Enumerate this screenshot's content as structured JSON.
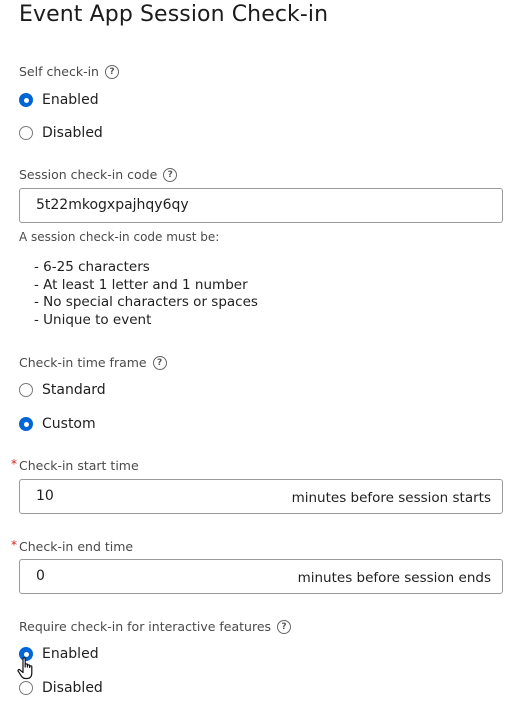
{
  "page": {
    "title": "Event App Session Check-in"
  },
  "self_checkin": {
    "label": "Self check-in",
    "options": [
      {
        "label": "Enabled",
        "selected": true
      },
      {
        "label": "Disabled",
        "selected": false
      }
    ]
  },
  "session_code": {
    "label": "Session check-in code",
    "value": "5t22mkogxpajhqy6qy",
    "note": "A session check-in code must be:",
    "rules": [
      "- 6-25 characters",
      "- At least 1 letter and 1 number",
      "- No special characters or spaces",
      "- Unique to event"
    ]
  },
  "timeframe": {
    "label": "Check-in time frame",
    "options": [
      {
        "label": "Standard",
        "selected": false
      },
      {
        "label": "Custom",
        "selected": true
      }
    ]
  },
  "start_time": {
    "required_mark": "*",
    "label": "Check-in start time",
    "value": "10",
    "suffix": "minutes before session starts"
  },
  "end_time": {
    "required_mark": "*",
    "label": "Check-in end time",
    "value": "0",
    "suffix": "minutes before session ends"
  },
  "interactive": {
    "label": "Require check-in for interactive features",
    "options": [
      {
        "label": "Enabled",
        "selected": true
      },
      {
        "label": "Disabled",
        "selected": false
      }
    ]
  },
  "help_glyph": "?",
  "icons": {
    "help": "question-circle-icon",
    "cursor": "hand-pointer-icon"
  },
  "colors": {
    "accent": "#0066d6",
    "required": "#d0261d"
  }
}
